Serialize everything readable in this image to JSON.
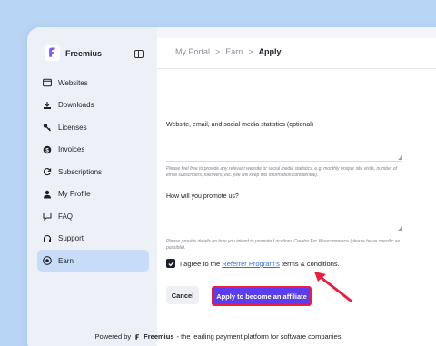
{
  "app": {
    "name": "Freemius"
  },
  "sidebar": {
    "items": [
      {
        "label": "Websites",
        "icon": "browser-icon"
      },
      {
        "label": "Downloads",
        "icon": "download-icon"
      },
      {
        "label": "Licenses",
        "icon": "key-icon"
      },
      {
        "label": "Invoices",
        "icon": "dollar-icon"
      },
      {
        "label": "Subscriptions",
        "icon": "refresh-icon"
      },
      {
        "label": "My Profile",
        "icon": "user-icon"
      },
      {
        "label": "FAQ",
        "icon": "chat-icon"
      },
      {
        "label": "Support",
        "icon": "headset-icon"
      },
      {
        "label": "Earn",
        "icon": "coin-icon",
        "active": true
      }
    ]
  },
  "breadcrumb": {
    "item1": "My Portal",
    "item2": "Earn",
    "current": "Apply",
    "separator": ">"
  },
  "form": {
    "stats_label": "Website, email, and social media statistics (optional)",
    "stats_help": "Please feel free to provide any relevant website or social media statistics, e.g. monthly unique site visits, number of email subscribers, followers, etc. (we will keep this information confidential).",
    "promote_label": "How will you promote us?",
    "promote_help": "Please provide details on how you intend to promote Locations Creator For Woocommerce (please be as specific as possible).",
    "agree_prefix": "I agree to the",
    "agree_link": "Referrer Program's",
    "agree_suffix": "terms & conditions.",
    "agree_checked": true,
    "cancel_label": "Cancel",
    "apply_label": "Apply to become an affiliate"
  },
  "footer": {
    "prefix": "Powered by",
    "brand": "Freemius",
    "suffix": "- the leading payment platform for software companies"
  },
  "colors": {
    "accent": "#5b3df0",
    "highlight": "#e8203f",
    "active_bg": "#c7dcf9",
    "link": "#3b6fd4"
  }
}
